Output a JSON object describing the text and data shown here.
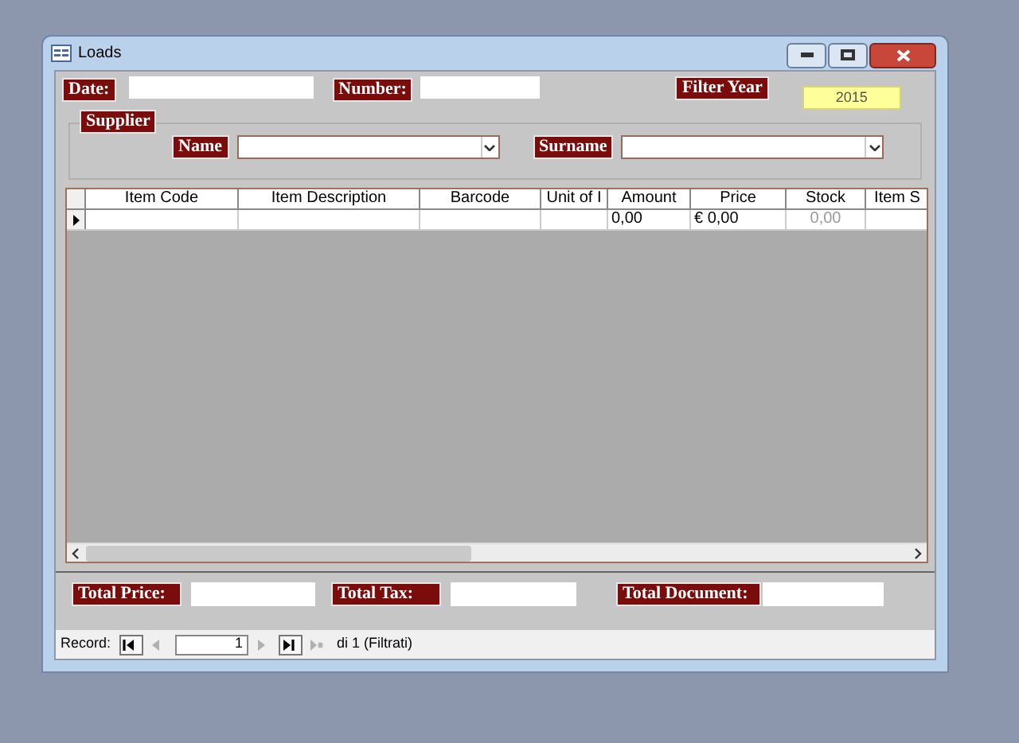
{
  "window": {
    "title": "Loads"
  },
  "header": {
    "date_label": "Date:",
    "number_label": "Number:",
    "filter_year_label": "Filter Year",
    "filter_year_value": "2015"
  },
  "supplier": {
    "label": "Supplier",
    "name_label": "Name",
    "surname_label": "Surname"
  },
  "grid": {
    "columns": [
      "Item Code",
      "Item Description",
      "Barcode",
      "Unit of I",
      "Amount",
      "Price",
      "Stock",
      "Item S"
    ],
    "rows": [
      {
        "current": true,
        "amount": "0,00",
        "price": "€ 0,00",
        "stock": "0,00",
        "stock_disabled": true
      }
    ]
  },
  "totals": [
    {
      "label": "Total Price:"
    },
    {
      "label": "Total Tax:"
    },
    {
      "label": "Total Document:"
    }
  ],
  "record_nav": {
    "label": "Record:",
    "current": "1",
    "of_text": "di 1 (Filtrati)",
    "buttons": [
      {
        "kind": "first",
        "disabled": false
      },
      {
        "kind": "prev",
        "disabled": true
      },
      {
        "kind": "next",
        "disabled": true
      },
      {
        "kind": "last",
        "disabled": false
      },
      {
        "kind": "new",
        "disabled": true
      }
    ]
  }
}
